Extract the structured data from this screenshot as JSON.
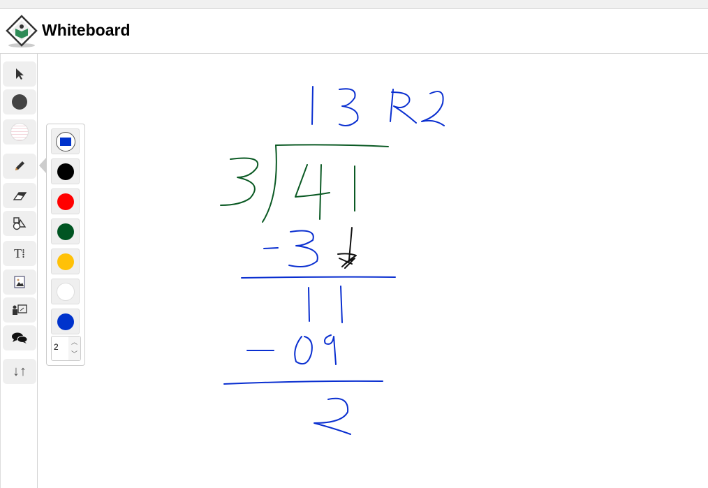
{
  "header": {
    "title": "Whiteboard"
  },
  "toolbar": {
    "items": [
      {
        "name": "select-tool",
        "icon": "cursor-arrow-icon"
      },
      {
        "name": "stroke-color",
        "icon": "dark-circle-icon"
      },
      {
        "name": "background",
        "icon": "lined-circle-icon"
      },
      {
        "name": "pencil-tool",
        "icon": "pencil-icon"
      },
      {
        "name": "eraser-tool",
        "icon": "eraser-icon"
      },
      {
        "name": "shapes-tool",
        "icon": "shapes-icon"
      },
      {
        "name": "text-tool",
        "icon": "text-icon",
        "glyph": "T⁞"
      },
      {
        "name": "image-tool",
        "icon": "image-icon"
      },
      {
        "name": "presenter-tool",
        "icon": "presenter-icon"
      },
      {
        "name": "chat-tool",
        "icon": "chat-bubbles-icon"
      },
      {
        "name": "sort-tool",
        "icon": "arrows-up-down-icon",
        "glyph": "↓↑"
      }
    ]
  },
  "palette": {
    "selected": "#0033cc",
    "colors": [
      "#000000",
      "#ff0000",
      "#005522",
      "#ffc107",
      "#ffffff",
      "#0033cc"
    ],
    "stroke_width": "2"
  },
  "strokes_colors": {
    "blue": "#0a2fd0",
    "green": "#0b5a24",
    "black": "#111111"
  }
}
